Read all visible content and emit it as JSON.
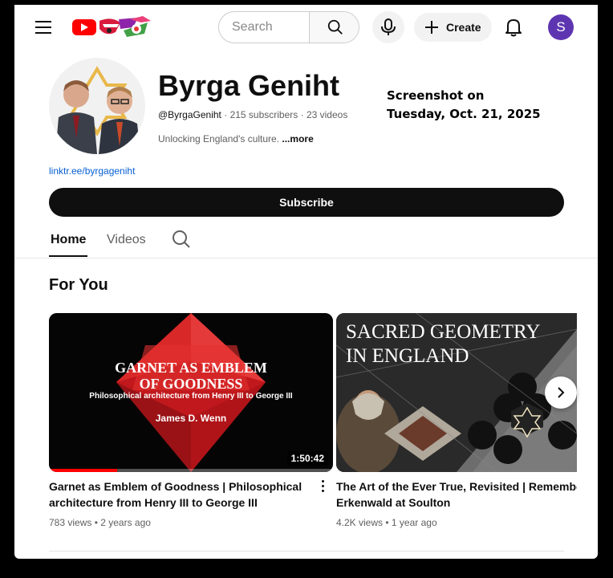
{
  "header": {
    "search_placeholder": "Search",
    "create_label": "Create",
    "avatar_letter": "S"
  },
  "channel": {
    "name": "Byrga Geniht",
    "handle": "@ByrgaGeniht",
    "subscribers": "215 subscribers",
    "videos": "23 videos",
    "separator": " · ",
    "description": "Unlocking England's culture. ",
    "more_label": "...more",
    "link": "linktr.ee/byrgageniht",
    "subscribe_label": "Subscribe"
  },
  "annotation": {
    "line1": "Screenshot on",
    "line2": "Tuesday, Oct. 21, 2025"
  },
  "tabs": {
    "home": "Home",
    "videos": "Videos"
  },
  "section": {
    "title": "For You"
  },
  "videos": [
    {
      "thumb_title_1": "GARNET AS EMBLEM",
      "thumb_title_2": "OF GOODNESS",
      "thumb_subtitle": "Philosophical architecture from Henry III to George III",
      "thumb_author": "James D. Wenn",
      "duration": "1:50:42",
      "progress": 0.24,
      "title_line1": "Garnet as Emblem of Goodness | Philosophical",
      "title_line2": "architecture from Henry III to George III",
      "views": "783 views",
      "age": "2 years ago"
    },
    {
      "thumb_title_1": "SACRED GEOMETRY",
      "thumb_title_2": "IN ENGLAND",
      "title_line1": "The Art of the Ever True, Revisited | Remembe",
      "title_line2": "Erkenwald at Soulton",
      "views": "4.2K views",
      "age": "1 year ago"
    }
  ],
  "meta_separator": " • "
}
